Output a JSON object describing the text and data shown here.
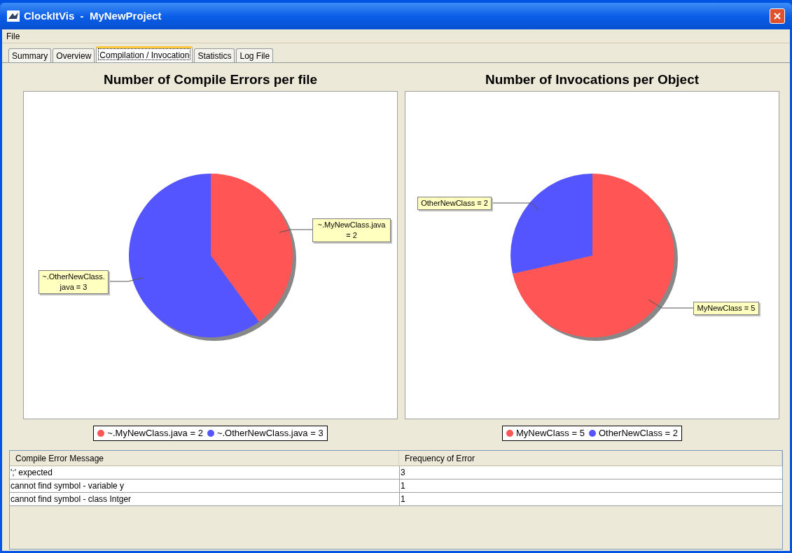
{
  "window": {
    "title": "ClockItVis  -  MyNewProject"
  },
  "menu": [
    "File"
  ],
  "tabs": [
    {
      "label": "Summary",
      "selected": false
    },
    {
      "label": "Overview",
      "selected": false
    },
    {
      "label": "Compilation / Invocation",
      "selected": true
    },
    {
      "label": "Statistics",
      "selected": false
    },
    {
      "label": "Log File",
      "selected": false
    }
  ],
  "charts": [
    {
      "chart_data": {
        "type": "pie",
        "title": "Number of Compile Errors per file",
        "categories": [
          "~.MyNewClass.java = 2",
          "~.OtherNewClass.java = 3"
        ],
        "values": [
          2,
          3
        ]
      },
      "legend": [
        {
          "label": "~.MyNewClass.java = 2",
          "color": "#ff5555"
        },
        {
          "label": "~.OtherNewClass.java = 3",
          "color": "#5555ff"
        }
      ]
    },
    {
      "chart_data": {
        "type": "pie",
        "title": "Number of Invocations per Object",
        "categories": [
          "MyNewClass = 5",
          "OtherNewClass = 2"
        ],
        "values": [
          5,
          2
        ]
      },
      "legend": [
        {
          "label": "MyNewClass = 5",
          "color": "#ff5555"
        },
        {
          "label": "OtherNewClass = 2",
          "color": "#5555ff"
        }
      ]
    }
  ],
  "table": {
    "columns": [
      "Compile Error Message",
      "Frequency of Error"
    ],
    "rows": [
      [
        "';' expected",
        "3"
      ],
      [
        "cannot find symbol - variable y",
        "1"
      ],
      [
        "cannot find symbol - class Intger",
        "1"
      ]
    ]
  }
}
